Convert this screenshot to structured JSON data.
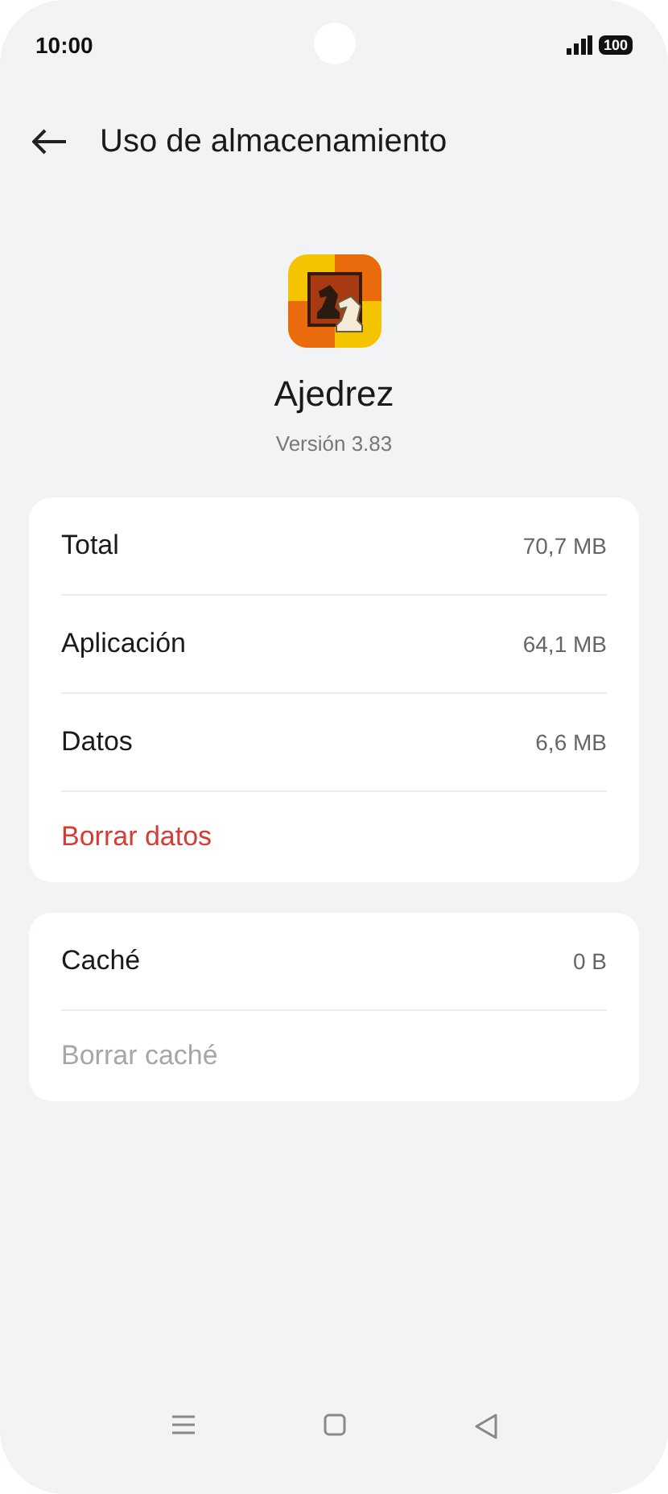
{
  "status_bar": {
    "time": "10:00",
    "battery": "100"
  },
  "header": {
    "title": "Uso de almacenamiento"
  },
  "app": {
    "name": "Ajedrez",
    "version": "Versión 3.83"
  },
  "cards": [
    {
      "rows": [
        {
          "kind": "size",
          "label": "Total",
          "value": "70,7 MB"
        },
        {
          "kind": "size",
          "label": "Aplicación",
          "value": "64,1 MB"
        },
        {
          "kind": "size",
          "label": "Datos",
          "value": "6,6 MB"
        },
        {
          "kind": "action",
          "label": "Borrar datos",
          "disabled": false
        }
      ]
    },
    {
      "rows": [
        {
          "kind": "size",
          "label": "Caché",
          "value": "0 B"
        },
        {
          "kind": "action",
          "label": "Borrar caché",
          "disabled": true
        }
      ]
    }
  ]
}
